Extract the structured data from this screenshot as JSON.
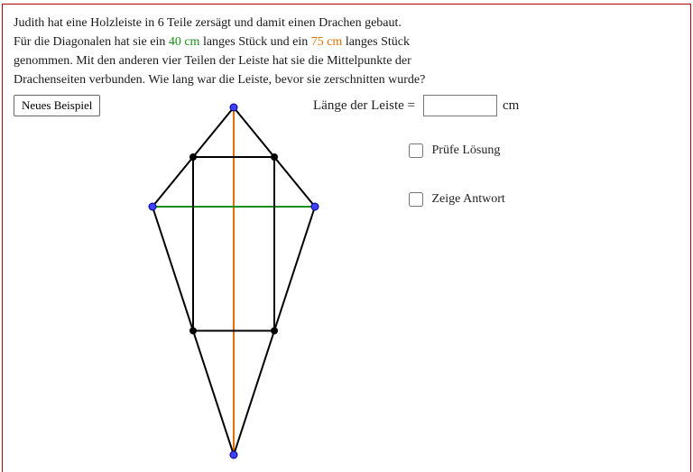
{
  "problem": {
    "line1": "Judith hat eine Holzleiste in 6 Teile zersägt und damit einen Drachen gebaut.",
    "line2a": "Für die Diagonalen hat sie ein ",
    "diag1": "40 cm",
    "line2b": " langes Stück und ein ",
    "diag2": "75 cm",
    "line2c": " langes Stück",
    "line3": "genommen. Mit den anderen vier Teilen der Leiste hat sie die Mittelpunkte der",
    "line4": "Drachenseiten verbunden. Wie lang war die Leiste, bevor sie zerschnitten wurde?"
  },
  "buttons": {
    "new_example": "Neues Beispiel"
  },
  "answer": {
    "label": "Länge der Leiste =",
    "value": "",
    "unit": "cm"
  },
  "checkboxes": {
    "check_solution": "Prüfe Lösung",
    "show_answer": "Zeige Antwort"
  },
  "diagram": {
    "diag1_color": "#e07000",
    "diag2_color": "#1a8f1a",
    "point_fill": "#4040ff",
    "point_stroke": "#000080",
    "line_color": "#000000"
  },
  "chart_data": {
    "type": "diagram",
    "shape": "kite",
    "diagonals_cm": {
      "horizontal": 40,
      "vertical": 75
    },
    "inner_quadrilateral": "midpoints of kite sides connected (rectangle)",
    "notes": "Vertical diagonal drawn in orange, horizontal diagonal drawn in green. Midpoint rectangle sides are black. Vertices shown as blue dots on kite corners, black dots on midpoints."
  }
}
